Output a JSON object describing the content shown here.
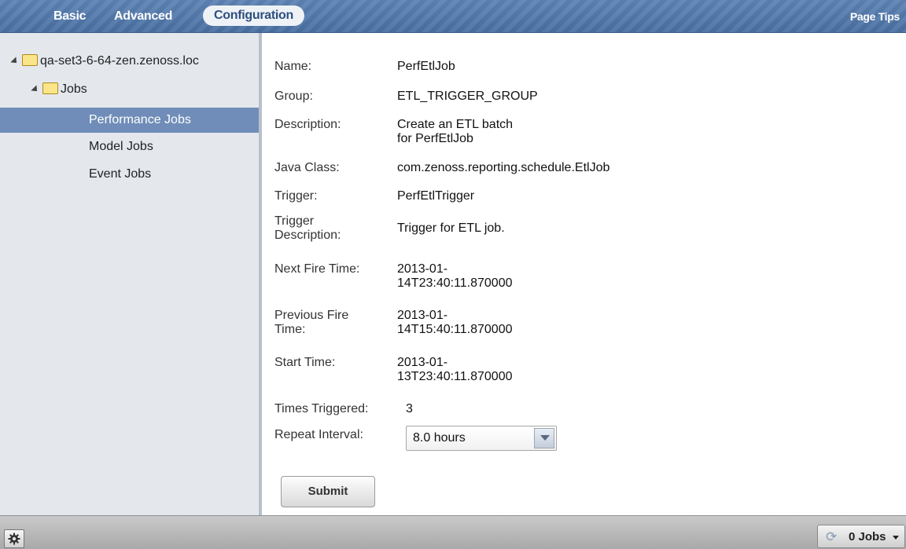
{
  "nav": {
    "tabs": [
      {
        "label": "Basic"
      },
      {
        "label": "Advanced"
      },
      {
        "label": "Configuration"
      }
    ],
    "page_tips": "Page Tips"
  },
  "tree": {
    "root": "qa-set3-6-64-zen.zenoss.loc",
    "folder": "Jobs",
    "items": [
      "Performance Jobs",
      "Model Jobs",
      "Event Jobs"
    ],
    "selected": "Performance Jobs"
  },
  "form": {
    "name": {
      "label": "Name:",
      "value": "PerfEtlJob"
    },
    "group": {
      "label": "Group:",
      "value": "ETL_TRIGGER_GROUP"
    },
    "description": {
      "label": "Description:",
      "value_line1": "Create an ETL batch",
      "value_line2": "for PerfEtlJob"
    },
    "java_class": {
      "label": "Java Class:",
      "value": "com.zenoss.reporting.schedule.EtlJob"
    },
    "trigger": {
      "label": "Trigger:",
      "value": "PerfEtlTrigger"
    },
    "trigger_description": {
      "label_line1": "Trigger",
      "label_line2": "Description:",
      "value": "Trigger for ETL job."
    },
    "next_fire_time": {
      "label": "Next Fire Time:",
      "value_line1": "2013-01-",
      "value_line2": "14T23:40:11.870000"
    },
    "previous_fire_time": {
      "label_line1": "Previous Fire",
      "label_line2": "Time:",
      "value_line1": "2013-01-",
      "value_line2": "14T15:40:11.870000"
    },
    "start_time": {
      "label": "Start Time:",
      "value_line1": "2013-01-",
      "value_line2": "13T23:40:11.870000"
    },
    "times_triggered": {
      "label": "Times Triggered:",
      "value": "3"
    },
    "repeat_interval": {
      "label": "Repeat Interval:",
      "value": "8.0 hours"
    },
    "submit_label": "Submit"
  },
  "footer": {
    "jobs_label": "0 Jobs",
    "icons": [
      "gear-icon",
      "refresh-icon",
      "caret-down-icon"
    ]
  },
  "colors": {
    "nav_bg": "#4a70a2",
    "selected_row": "#6f8db8",
    "sidebar_bg": "#e4e8ed"
  }
}
